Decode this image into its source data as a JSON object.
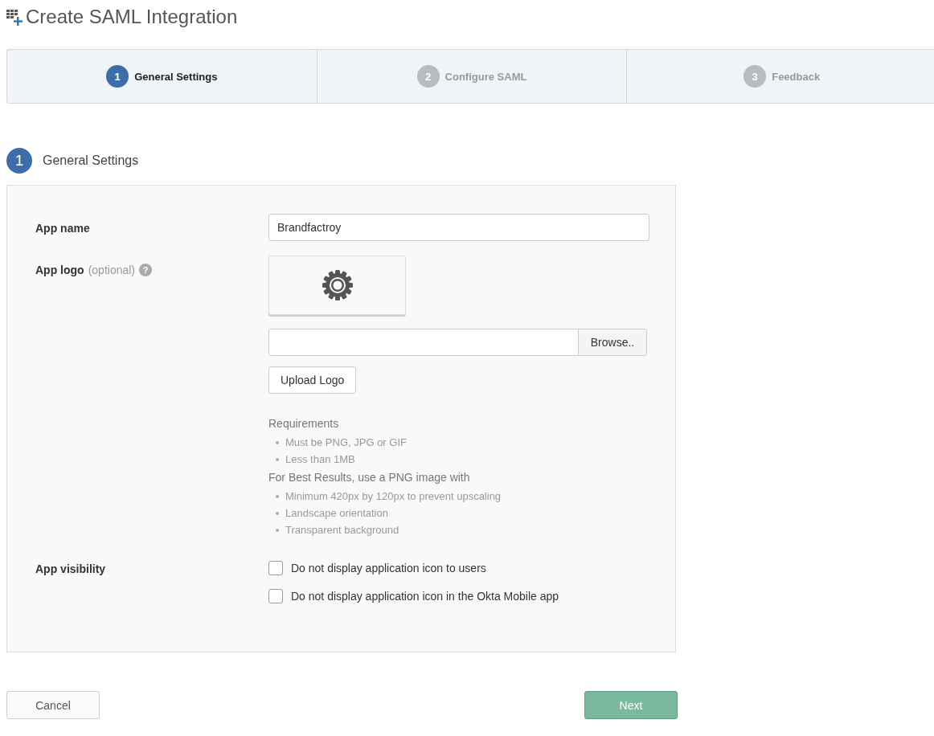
{
  "page_title": "Create SAML Integration",
  "steps": [
    {
      "number": "1",
      "label": "General Settings",
      "selected": true
    },
    {
      "number": "2",
      "label": "Configure SAML",
      "selected": false
    },
    {
      "number": "3",
      "label": "Feedback",
      "selected": false
    }
  ],
  "section": {
    "number": "1",
    "title": "General Settings"
  },
  "form": {
    "app_name": {
      "label": "App name",
      "value": "Brandfactroy"
    },
    "app_logo": {
      "label": "App logo",
      "optional": "(optional)",
      "help": "?",
      "browse_button": "Browse..",
      "upload_button": "Upload Logo",
      "requirements": {
        "title": "Requirements",
        "items": [
          "Must be PNG, JPG or GIF",
          "Less than 1MB"
        ]
      },
      "best_results": {
        "title": "For Best Results, use a PNG image with",
        "items": [
          "Minimum 420px by 120px to prevent upscaling",
          "Landscape orientation",
          "Transparent background"
        ]
      }
    },
    "app_visibility": {
      "label": "App visibility",
      "options": [
        {
          "label": "Do not display application icon to users",
          "checked": false
        },
        {
          "label": "Do not display application icon in the Okta Mobile app",
          "checked": false
        }
      ]
    }
  },
  "buttons": {
    "cancel": "Cancel",
    "next": "Next"
  }
}
